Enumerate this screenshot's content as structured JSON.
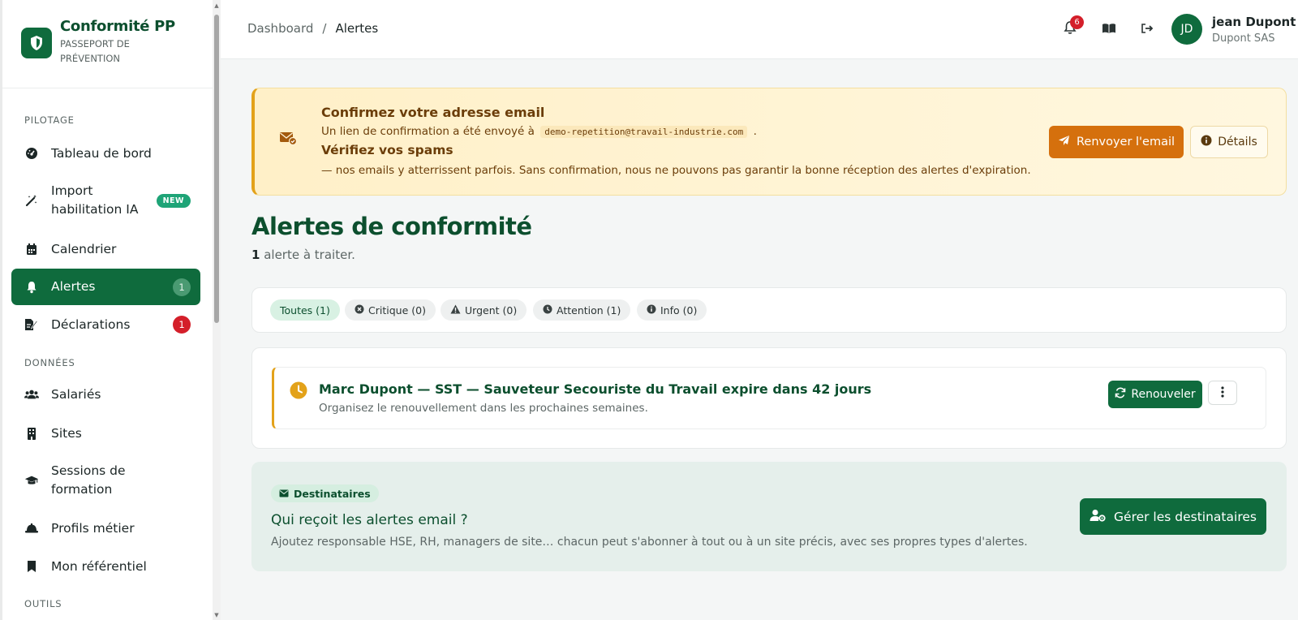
{
  "brand": {
    "title": "Conformité PP",
    "subtitle": "PASSEPORT DE PRÉVENTION",
    "icon": "shield-icon"
  },
  "sidebar": {
    "sections": {
      "pilotage": "PILOTAGE",
      "donnees": "DONNÉES",
      "outils": "OUTILS"
    },
    "items": [
      {
        "label": "Tableau de bord",
        "icon": "dashboard-gauge-icon"
      },
      {
        "label": "Import habilitation IA",
        "icon": "magic-wand-icon",
        "badge": "NEW"
      },
      {
        "label": "Calendrier",
        "icon": "calendar-icon"
      },
      {
        "label": "Alertes",
        "icon": "bell-icon",
        "badge": "1",
        "active": true
      },
      {
        "label": "Déclarations",
        "icon": "file-signature-icon",
        "badge": "1"
      },
      {
        "label": "Salariés",
        "icon": "users-icon"
      },
      {
        "label": "Sites",
        "icon": "building-icon"
      },
      {
        "label": "Sessions de formation",
        "icon": "graduation-cap-icon"
      },
      {
        "label": "Profils métier",
        "icon": "hard-hat-icon"
      },
      {
        "label": "Mon référentiel",
        "icon": "bookmark-icon"
      }
    ]
  },
  "header": {
    "breadcrumb": {
      "root": "Dashboard",
      "sep": "/",
      "current": "Alertes"
    },
    "notifications": "6",
    "user": {
      "initials": "JD",
      "name": "jean Dupont",
      "org": "Dupont SAS"
    }
  },
  "banner": {
    "title": "Confirmez votre adresse email",
    "line1_prefix": "Un lien de confirmation a été envoyé à",
    "email": "demo-repetition@travail-industrie.com",
    "line1_suffix": ".",
    "spam_title": "Vérifiez vos spams",
    "line2": "— nos emails y atterrissent parfois. Sans confirmation, nous ne pouvons pas garantir la bonne réception des alertes d'expiration.",
    "resend_label": "Renvoyer l'email",
    "details_label": "Détails"
  },
  "page": {
    "title": "Alertes de conformité",
    "count": "1",
    "subtitle_rest": " alerte à traiter."
  },
  "filters": [
    {
      "label": "Toutes (1)",
      "active": true
    },
    {
      "label": "Critique (0)",
      "icon": "x-circle-icon"
    },
    {
      "label": "Urgent (0)",
      "icon": "warning-triangle-icon"
    },
    {
      "label": "Attention (1)",
      "icon": "clock-icon"
    },
    {
      "label": "Info (0)",
      "icon": "info-circle-icon"
    }
  ],
  "alerts": [
    {
      "title": "Marc Dupont — SST — Sauveteur Secouriste du Travail expire dans 42 jours",
      "description": "Organisez le renouvellement dans les prochaines semaines.",
      "renew_label": "Renouveler"
    }
  ],
  "recipients": {
    "chip": "Destinataires",
    "title": "Qui reçoit les alertes email ?",
    "description": "Ajoutez responsable HSE, RH, managers de site… chacun peut s'abonner à tout ou à un site précis, avec ses propres types d'alertes.",
    "button": "Gérer les destinataires"
  },
  "colors": {
    "brand_green": "#0f6b3d",
    "warning_amber": "#e3a21a",
    "orange_button": "#d5700d",
    "danger_red": "#d41f2a"
  }
}
